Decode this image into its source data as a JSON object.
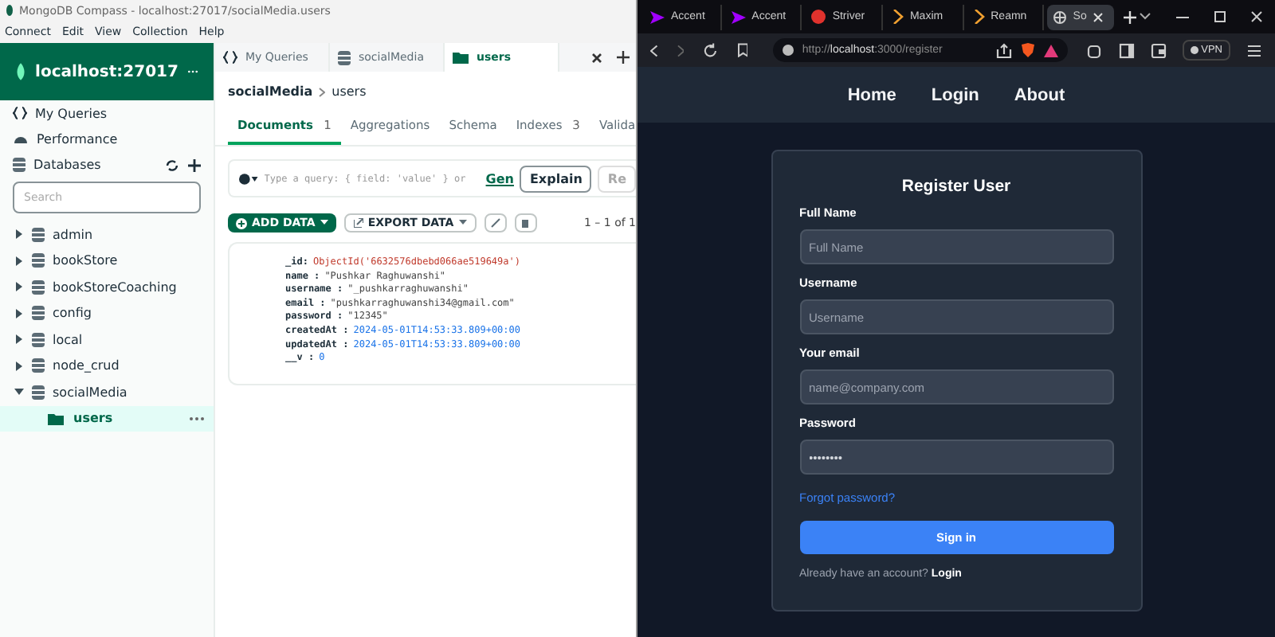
{
  "compass": {
    "title": "MongoDB Compass - localhost:27017/socialMedia.users",
    "menu": [
      "Connect",
      "Edit",
      "View",
      "Collection",
      "Help"
    ],
    "connection": {
      "name": "localhost:27017"
    },
    "nav": [
      {
        "label": "My Queries",
        "kind": "queries"
      },
      {
        "label": "Performance",
        "kind": "performance"
      }
    ],
    "databases": {
      "label": "Databases"
    },
    "search": {
      "placeholder": "Search"
    },
    "tree": [
      {
        "label": "admin",
        "expanded": false
      },
      {
        "label": "bookStore",
        "expanded": false
      },
      {
        "label": "bookStoreCoaching",
        "expanded": false
      },
      {
        "label": "config",
        "expanded": false
      },
      {
        "label": "local",
        "expanded": false
      },
      {
        "label": "node_crud",
        "expanded": false
      },
      {
        "label": "socialMedia",
        "expanded": true,
        "children": [
          {
            "label": "users",
            "selected": true
          }
        ]
      }
    ],
    "tabs": [
      {
        "label": "My Queries",
        "kind": "queries",
        "selected": false
      },
      {
        "label": "socialMedia",
        "kind": "database",
        "selected": false
      },
      {
        "label": "users",
        "kind": "collection",
        "selected": true
      }
    ],
    "breadcrumb": [
      "socialMedia",
      "users"
    ],
    "subtabs": [
      {
        "label": "Documents",
        "count": "1",
        "selected": true
      },
      {
        "label": "Aggregations",
        "selected": false
      },
      {
        "label": "Schema",
        "selected": false
      },
      {
        "label": "Indexes",
        "count": "3",
        "selected": false
      },
      {
        "label": "Valida",
        "selected": false
      }
    ],
    "query": {
      "placeholder": "Type a query: { field: 'value' } or",
      "gen": "Gen",
      "explain": "Explain",
      "reset": "Re"
    },
    "toolbar": {
      "add": "ADD DATA",
      "export": "EXPORT DATA",
      "pagination": "1 – 1 of 1"
    },
    "document": [
      {
        "key": "_id:",
        "value": "ObjectId('6632576dbebd066ae519649a')",
        "kind": "objectid"
      },
      {
        "key": "name :",
        "value": "\"Pushkar Raghuwanshi\"",
        "kind": "string"
      },
      {
        "key": "username :",
        "value": "\"_pushkarraghuwanshi\"",
        "kind": "string"
      },
      {
        "key": "email :",
        "value": "\"pushkarraghuwanshi34@gmail.com\"",
        "kind": "string"
      },
      {
        "key": "password :",
        "value": "\"12345\"",
        "kind": "string"
      },
      {
        "key": "createdAt :",
        "value": "2024-05-01T14:53:33.809+00:00",
        "kind": "date"
      },
      {
        "key": "updatedAt :",
        "value": "2024-05-01T14:53:33.809+00:00",
        "kind": "date"
      },
      {
        "key": "__v :",
        "value": "0",
        "kind": "number"
      }
    ]
  },
  "browser": {
    "tabs": [
      {
        "label": "Accent",
        "kind": "chevron",
        "selected": false
      },
      {
        "label": "Accent",
        "kind": "chevron",
        "selected": false
      },
      {
        "label": "Striver",
        "kind": "badge",
        "selected": false
      },
      {
        "label": "Maxim",
        "kind": "code",
        "selected": false
      },
      {
        "label": "Reamn",
        "kind": "code",
        "selected": false
      },
      {
        "label": "So",
        "kind": "globe",
        "selected": true
      }
    ],
    "url": {
      "scheme": "http://",
      "host": "localhost",
      "rest": ":3000/register"
    },
    "vpn": "VPN",
    "nav": [
      "Home",
      "Login",
      "About"
    ],
    "form": {
      "title": "Register User",
      "fields": [
        {
          "label": "Full Name",
          "placeholder": "Full Name"
        },
        {
          "label": "Username",
          "placeholder": "Username"
        },
        {
          "label": "Your email",
          "placeholder": "name@company.com"
        },
        {
          "label": "Password",
          "value": "••••••••"
        }
      ],
      "forgot": "Forgot password?",
      "submit": "Sign in",
      "footer": "Already have an account?",
      "footer_link": "Login"
    }
  }
}
